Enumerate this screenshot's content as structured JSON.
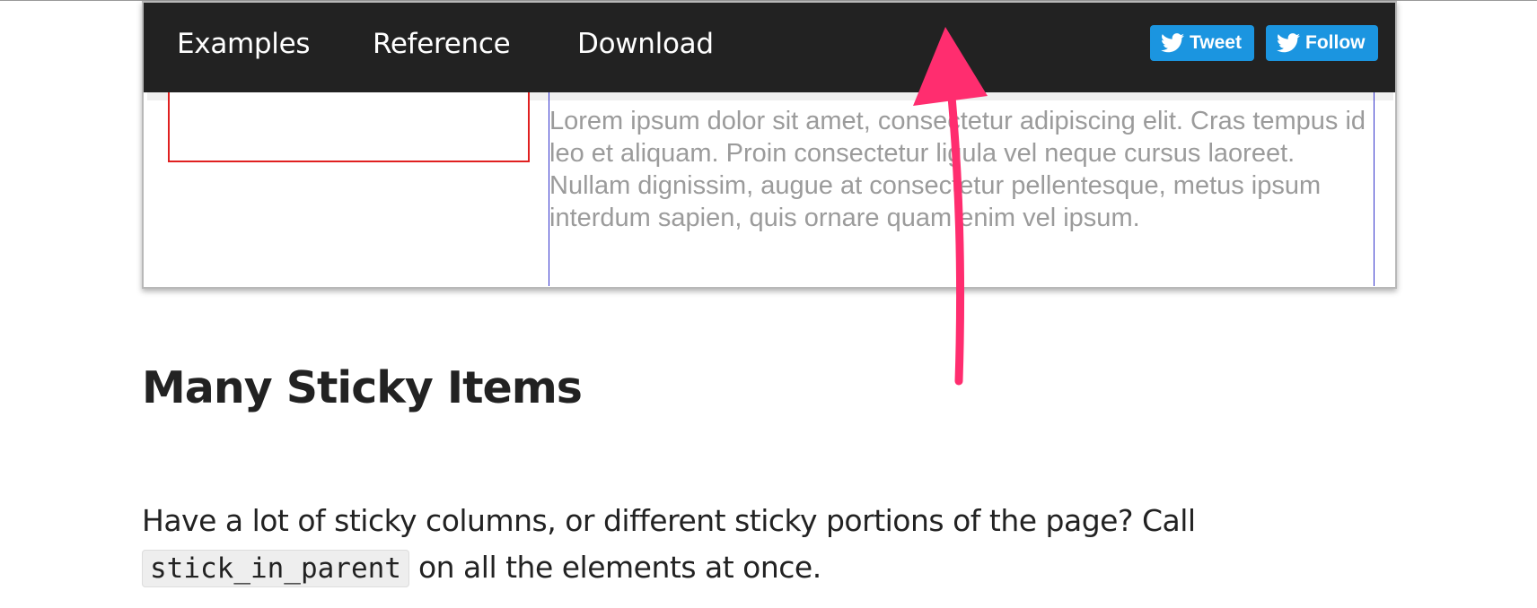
{
  "nav": {
    "links": [
      {
        "label": "Examples"
      },
      {
        "label": "Reference"
      },
      {
        "label": "Download"
      }
    ],
    "tweet_label": "Tweet",
    "follow_label": "Follow"
  },
  "demo": {
    "lorem": "Lorem ipsum dolor sit amet, consectetur adipiscing elit. Cras tempus id leo et aliquam. Proin consectetur ligula vel neque cursus laoreet. Nullam dignissim, augue at consectetur pellentesque, metus ipsum interdum sapien, quis ornare quam enim vel ipsum."
  },
  "section": {
    "title": "Many Sticky Items",
    "text_before": "Have a lot of sticky columns, or different sticky portions of the page? Call",
    "code": "stick_in_parent",
    "text_after": " on all the elements at once."
  },
  "colors": {
    "topbar": "#222222",
    "twitter_blue": "#1b95e0",
    "arrow": "#ff2d6f",
    "demo_border": "#e02020",
    "column_rule": "#3333cc"
  },
  "icons": [
    "twitter-bird-icon",
    "annotation-arrow"
  ]
}
